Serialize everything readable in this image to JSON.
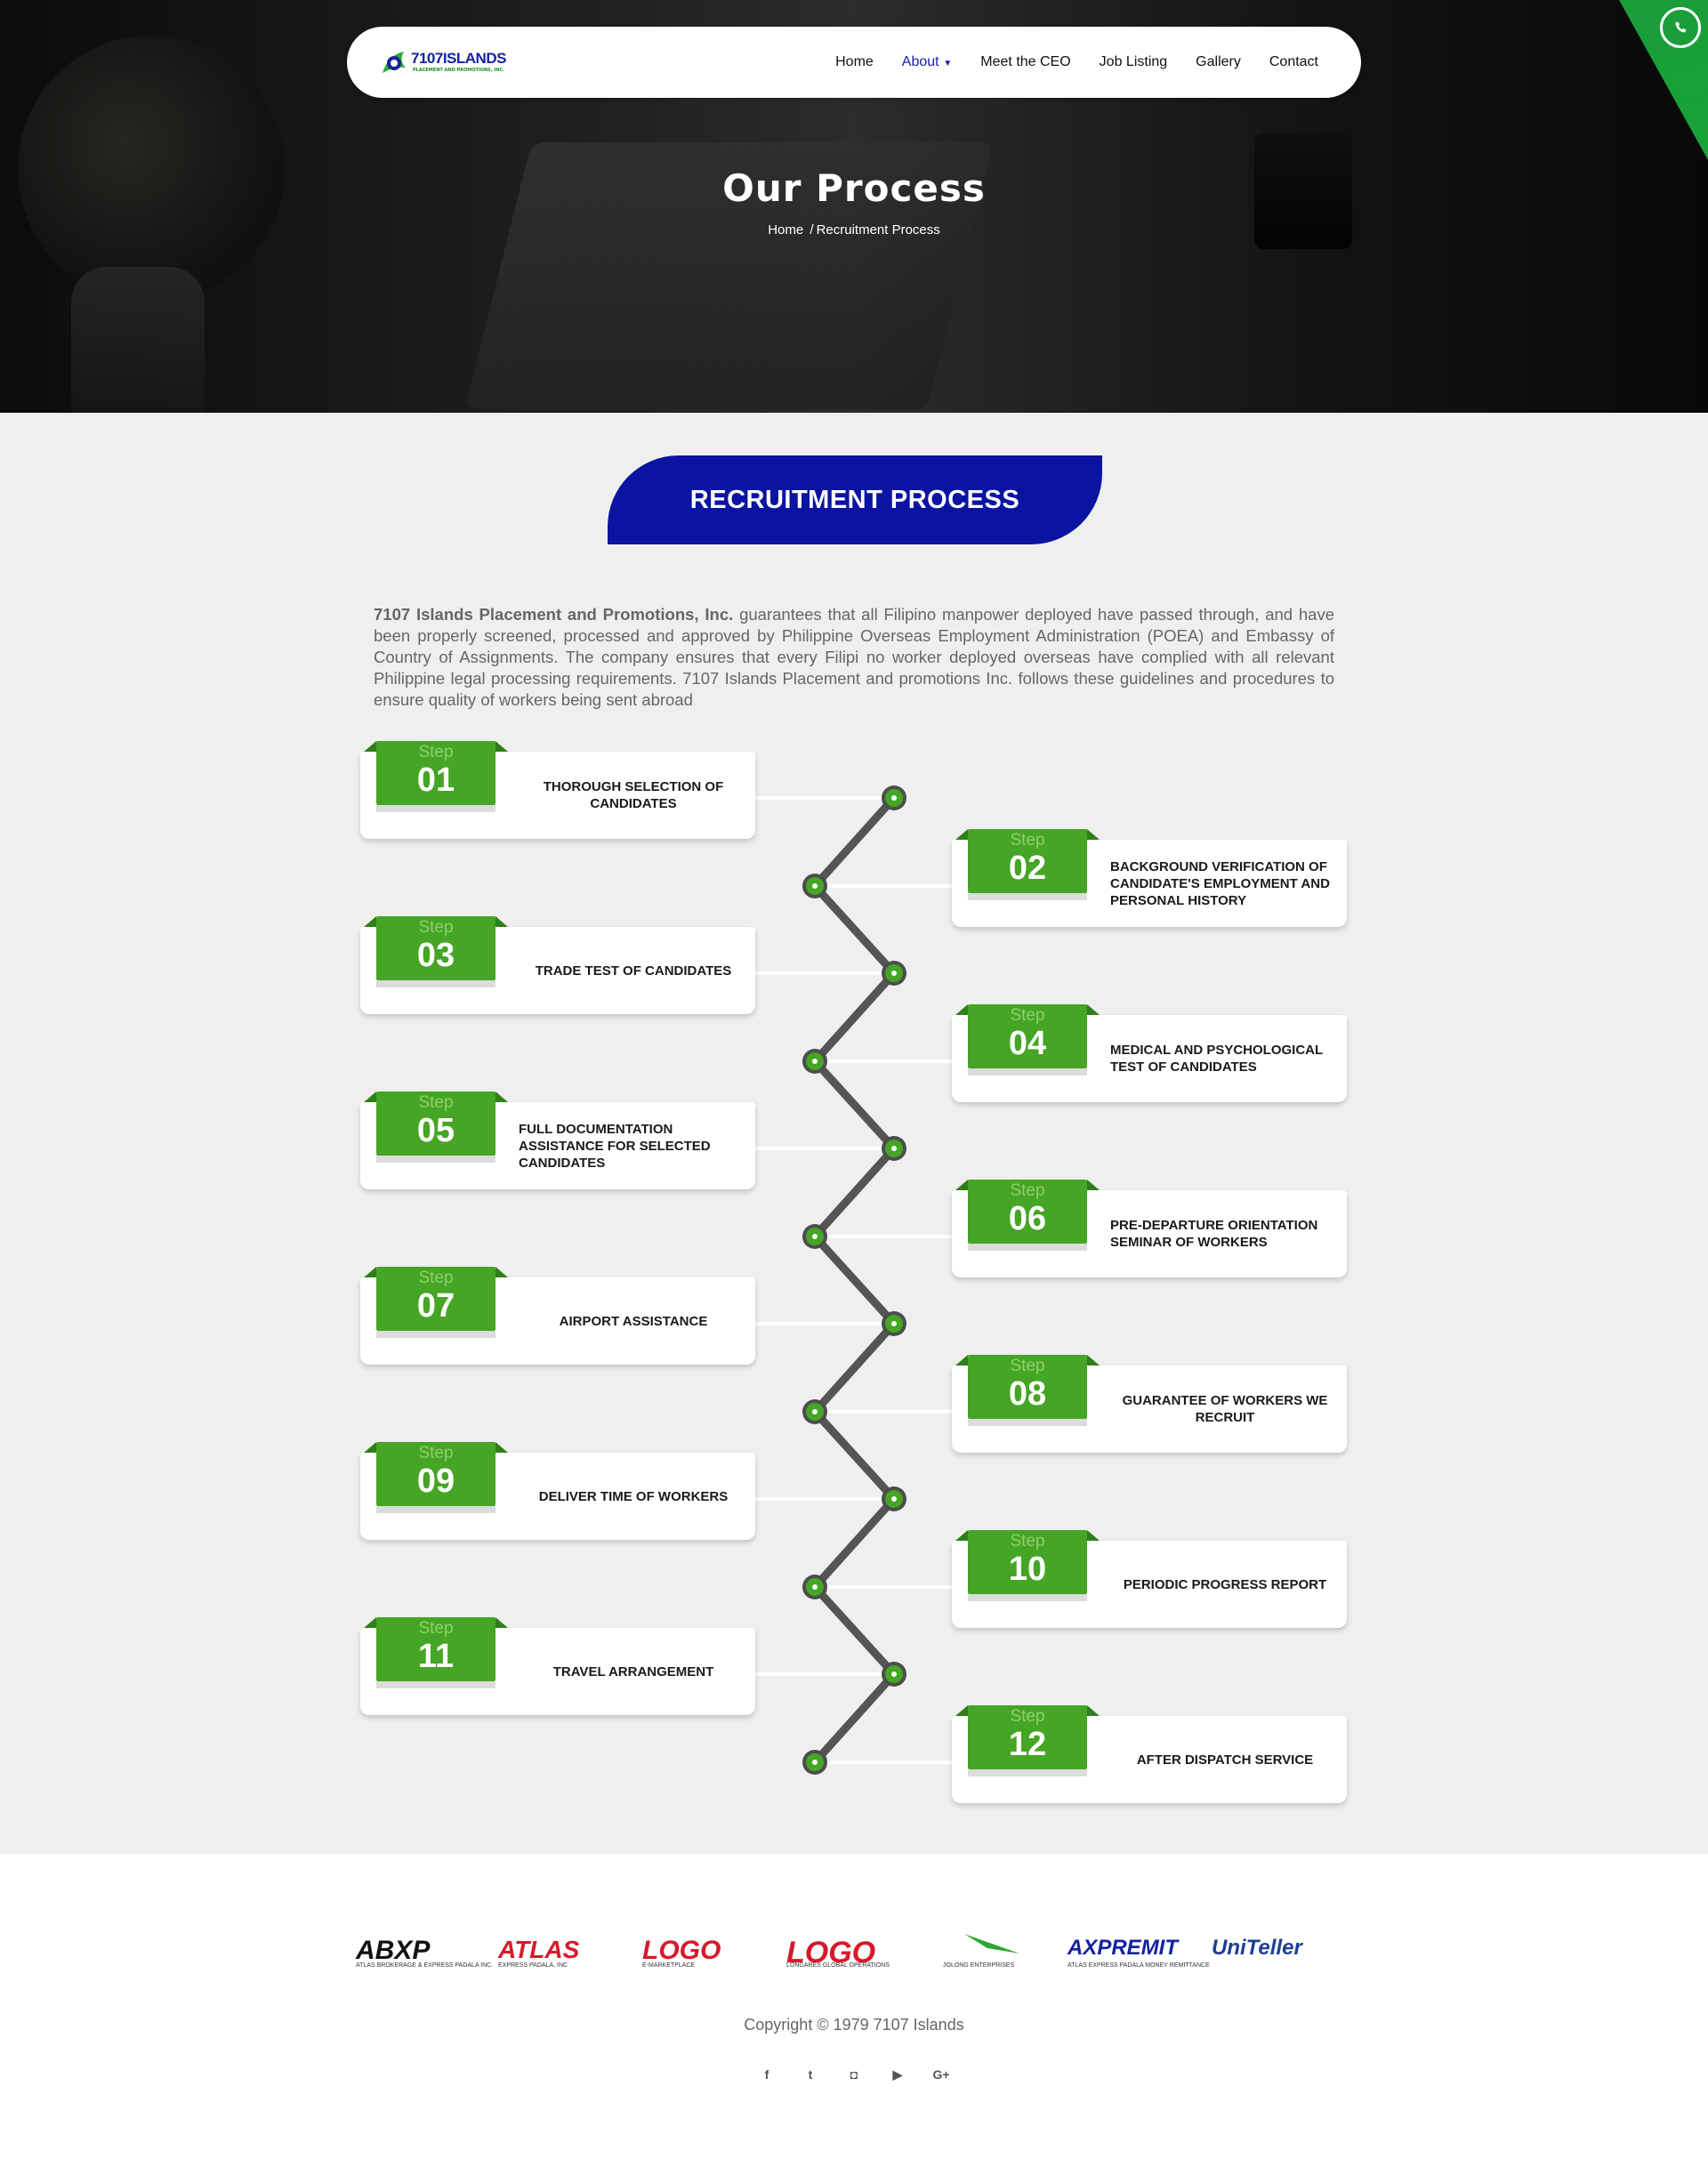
{
  "brand": {
    "logo_text": "7107ISLANDS",
    "logo_sub": "PLACEMENT AND PROMOTIONS, INC.",
    "primary_color": "#0a14a0",
    "accent_color": "#45a524"
  },
  "nav": {
    "items": [
      {
        "label": "Home",
        "active": false
      },
      {
        "label": "About",
        "active": true,
        "has_dropdown": true
      },
      {
        "label": "Meet the CEO",
        "active": false
      },
      {
        "label": "Job Listing",
        "active": false
      },
      {
        "label": "Gallery",
        "active": false
      },
      {
        "label": "Contact",
        "active": false
      }
    ],
    "dropdown_icon": "caret-down-icon"
  },
  "hero": {
    "title": "Our Process",
    "breadcrumb": {
      "home": "Home",
      "separator": "/",
      "current": "Recruitment Process"
    }
  },
  "whatsapp": {
    "icon": "whatsapp-icon",
    "color": "#18a336"
  },
  "section": {
    "title": "RECRUITMENT PROCESS",
    "intro_company": "7107 Islands Placement and Promotions, Inc.",
    "intro_text": " guarantees that all Filipino manpower deployed have passed through, and have been properly screened, processed and approved by Philippine Overseas Employment Administration (POEA) and Embassy of Country of Assignments. The company ensures that every Filipi no worker deployed overseas have complied with all relevant Philippine legal processing requirements. 7107 Islands Placement and promotions Inc. follows these guidelines and procedures to ensure quality of workers being sent abroad"
  },
  "steps": [
    {
      "word": "Step",
      "number": "01",
      "text": "Thorough selection of candidates"
    },
    {
      "word": "Step",
      "number": "02",
      "text": "Background verification of candidate's employment and personal history"
    },
    {
      "word": "Step",
      "number": "03",
      "text": "Trade test of candidates"
    },
    {
      "word": "Step",
      "number": "04",
      "text": "Medical and psychological test of candidates"
    },
    {
      "word": "Step",
      "number": "05",
      "text": "Full documentation assistance for selected candidates"
    },
    {
      "word": "Step",
      "number": "06",
      "text": "Pre-departure orientation seminar of workers"
    },
    {
      "word": "Step",
      "number": "07",
      "text": "Airport Assistance"
    },
    {
      "word": "Step",
      "number": "08",
      "text": "Guarantee of workers we recruit"
    },
    {
      "word": "Step",
      "number": "09",
      "text": "Deliver time of workers"
    },
    {
      "word": "Step",
      "number": "10",
      "text": "Periodic progress report"
    },
    {
      "word": "Step",
      "number": "11",
      "text": "Travel arrangement"
    },
    {
      "word": "Step",
      "number": "12",
      "text": "After dispatch service"
    }
  ],
  "partners": [
    {
      "name": "ABXP",
      "sub": "ATLAS BROKERAGE & EXPRESS PADALA INC.",
      "color": "#111111"
    },
    {
      "name": "ATLAS",
      "sub": "EXPRESS PADALA, INC",
      "color": "#d8192a"
    },
    {
      "name": "LOGO",
      "sub": "E-MARKETPLACE",
      "color": "#d8192a"
    },
    {
      "name": "LOGO",
      "sub": "LONGARES GLOBAL OPERATIONS",
      "color": "#d8192a"
    },
    {
      "name": "",
      "sub": "JOLONG ENTERPRISES",
      "color": "#2aa832"
    },
    {
      "name": "AXPREMIT",
      "sub": "ATLAS EXPRESS PADALA MONEY REMITTANCE",
      "color": "#15229e"
    },
    {
      "name": "UniTeller",
      "sub": "",
      "color": "#1c3f94"
    }
  ],
  "footer": {
    "copyright": "Copyright © 1979 7107 Islands",
    "social": [
      {
        "icon": "facebook-icon",
        "glyph": "f"
      },
      {
        "icon": "twitter-icon",
        "glyph": "t"
      },
      {
        "icon": "instagram-icon",
        "glyph": "◘"
      },
      {
        "icon": "youtube-icon",
        "glyph": "▶"
      },
      {
        "icon": "google-plus-icon",
        "glyph": "G+"
      }
    ]
  }
}
